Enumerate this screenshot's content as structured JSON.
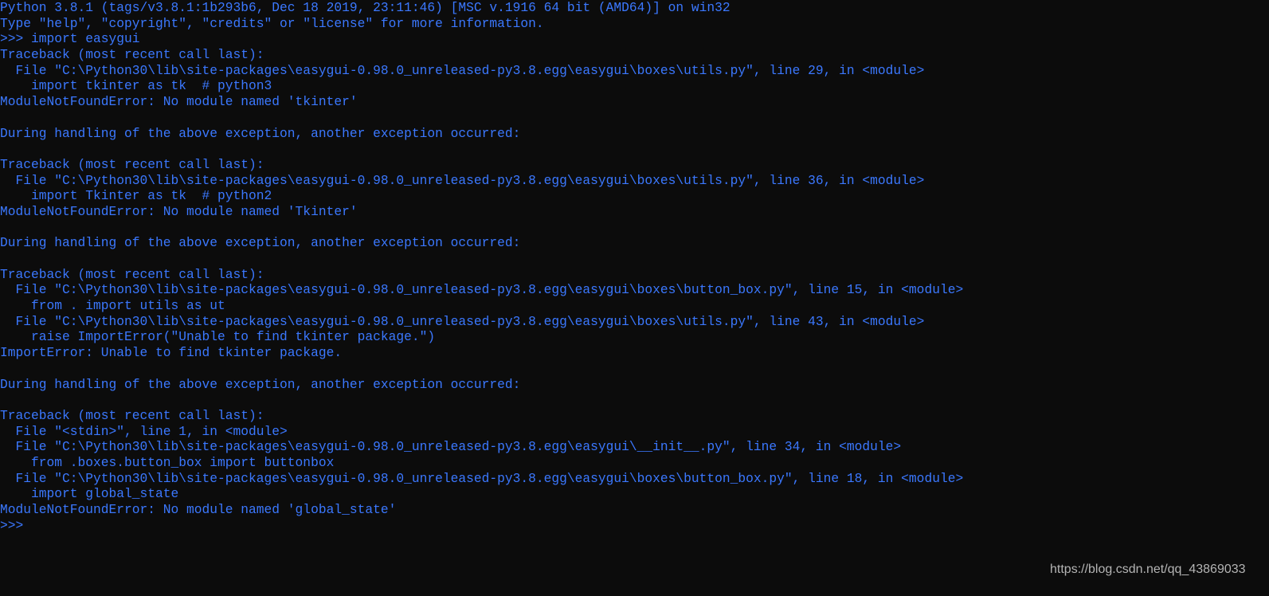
{
  "console": {
    "text_color": "#3b78ff",
    "background_color": "#0c0c0c",
    "lines": [
      "Python 3.8.1 (tags/v3.8.1:1b293b6, Dec 18 2019, 23:11:46) [MSC v.1916 64 bit (AMD64)] on win32",
      "Type \"help\", \"copyright\", \"credits\" or \"license\" for more information.",
      ">>> import easygui",
      "Traceback (most recent call last):",
      "  File \"C:\\Python30\\lib\\site-packages\\easygui-0.98.0_unreleased-py3.8.egg\\easygui\\boxes\\utils.py\", line 29, in <module>",
      "    import tkinter as tk  # python3",
      "ModuleNotFoundError: No module named 'tkinter'",
      "",
      "During handling of the above exception, another exception occurred:",
      "",
      "Traceback (most recent call last):",
      "  File \"C:\\Python30\\lib\\site-packages\\easygui-0.98.0_unreleased-py3.8.egg\\easygui\\boxes\\utils.py\", line 36, in <module>",
      "    import Tkinter as tk  # python2",
      "ModuleNotFoundError: No module named 'Tkinter'",
      "",
      "During handling of the above exception, another exception occurred:",
      "",
      "Traceback (most recent call last):",
      "  File \"C:\\Python30\\lib\\site-packages\\easygui-0.98.0_unreleased-py3.8.egg\\easygui\\boxes\\button_box.py\", line 15, in <module>",
      "    from . import utils as ut",
      "  File \"C:\\Python30\\lib\\site-packages\\easygui-0.98.0_unreleased-py3.8.egg\\easygui\\boxes\\utils.py\", line 43, in <module>",
      "    raise ImportError(\"Unable to find tkinter package.\")",
      "ImportError: Unable to find tkinter package.",
      "",
      "During handling of the above exception, another exception occurred:",
      "",
      "Traceback (most recent call last):",
      "  File \"<stdin>\", line 1, in <module>",
      "  File \"C:\\Python30\\lib\\site-packages\\easygui-0.98.0_unreleased-py3.8.egg\\easygui\\__init__.py\", line 34, in <module>",
      "    from .boxes.button_box import buttonbox",
      "  File \"C:\\Python30\\lib\\site-packages\\easygui-0.98.0_unreleased-py3.8.egg\\easygui\\boxes\\button_box.py\", line 18, in <module>",
      "    import global_state",
      "ModuleNotFoundError: No module named 'global_state'",
      ">>> "
    ]
  },
  "watermark": {
    "text": "https://blog.csdn.net/qq_43869033"
  }
}
